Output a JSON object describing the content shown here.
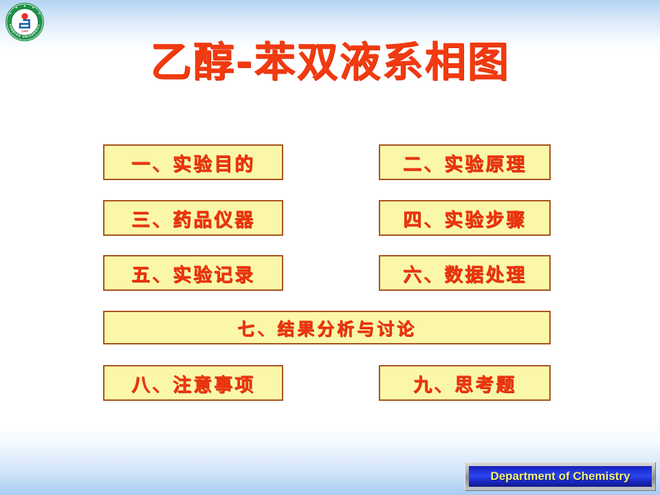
{
  "slide": {
    "title": "乙醇-苯双液系相图",
    "title_color": "#F23A10",
    "background_top_color": "#b4d3f2",
    "background_bottom_color": "#a9ccf3"
  },
  "logo": {
    "name": "yanbian-university-seal",
    "institution_english": "YANBIAN UNIVERSITY",
    "founded_year": "1949",
    "ring_color": "#1E9148",
    "mark_color": "#1A5FA8",
    "dot_color": "#E8302A"
  },
  "menu": {
    "box_fill": "#FAF8A8",
    "box_border": "#A8531A",
    "text_color": "#F03510",
    "items": [
      {
        "id": "objective",
        "label": "一、实验目的",
        "column": "left",
        "row": 1
      },
      {
        "id": "principle",
        "label": "二、实验原理",
        "column": "right",
        "row": 1
      },
      {
        "id": "apparatus",
        "label": "三、药品仪器",
        "column": "left",
        "row": 2
      },
      {
        "id": "procedure",
        "label": "四、实验步骤",
        "column": "right",
        "row": 2
      },
      {
        "id": "records",
        "label": "五、实验记录",
        "column": "left",
        "row": 3
      },
      {
        "id": "data",
        "label": "六、数据处理",
        "column": "right",
        "row": 3
      },
      {
        "id": "analysis",
        "label": "七、结果分析与讨论",
        "column": "wide",
        "row": 4
      },
      {
        "id": "notes",
        "label": "八、注意事项",
        "column": "left",
        "row": 5
      },
      {
        "id": "questions",
        "label": "九、思考题",
        "column": "right",
        "row": 5
      }
    ]
  },
  "footer": {
    "label": "Department of Chemistry",
    "text_color": "#F2F47A",
    "plate_color": "#1f33d8",
    "frame_color": "#9b9da1"
  }
}
